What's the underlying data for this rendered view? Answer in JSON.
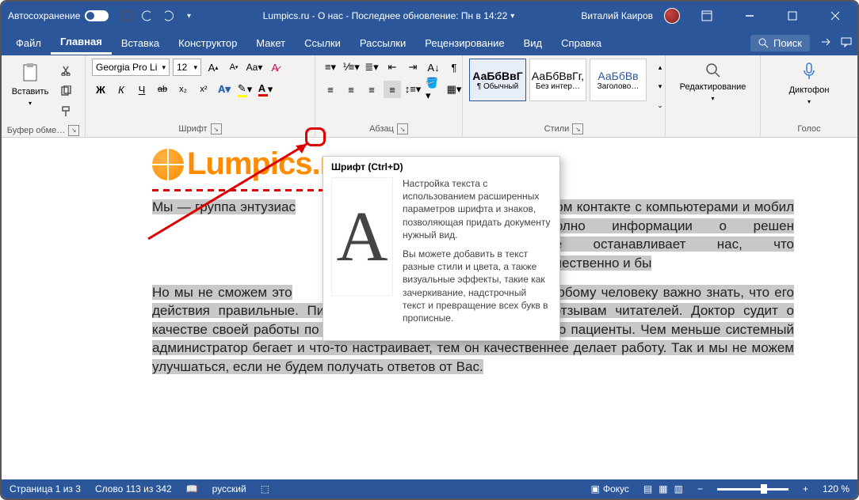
{
  "titlebar": {
    "autosave_label": "Автосохранение",
    "document_title": "Lumpics.ru - О нас - Последнее обновление: Пн в 14:22",
    "user_name": "Виталий Каиров"
  },
  "tabs": {
    "file": "Файл",
    "home": "Главная",
    "insert": "Вставка",
    "design": "Конструктор",
    "layout": "Макет",
    "references": "Ссылки",
    "mailings": "Рассылки",
    "review": "Рецензирование",
    "view": "Вид",
    "help": "Справка",
    "search_placeholder": "Поиск"
  },
  "ribbon": {
    "clipboard": {
      "paste": "Вставить",
      "group": "Буфер обме…"
    },
    "font": {
      "name": "Georgia Pro Li",
      "size": "12",
      "group": "Шрифт",
      "bold": "Ж",
      "italic": "К",
      "underline": "Ч",
      "strike": "ab",
      "sub": "x₂",
      "sup": "x²"
    },
    "paragraph": {
      "group": "Абзац"
    },
    "styles": {
      "group": "Стили",
      "sample": "АаБбВвГ",
      "sample2": "АаБбВвГг,",
      "sample3": "АаБбВв",
      "normal": "¶ Обычный",
      "nospacing": "Без интер…",
      "heading1": "Заголово…"
    },
    "editing": {
      "label": "Редактирование"
    },
    "voice": {
      "label": "Диктофон",
      "group": "Голос"
    }
  },
  "tooltip": {
    "title": "Шрифт (Ctrl+D)",
    "p1": "Настройка текста с использованием расширенных параметров шрифта и знаков, позволяющая придать документу нужный вид.",
    "p2": "Вы можете добавить в текст разные стили и цвета, а также визуальные эффекты, такие как зачеркивание, надстрочный текст и превращение всех букв в прописные."
  },
  "document": {
    "logo_text": "Lumpics.ru",
    "p1a": "Мы — группа энтузиас",
    "p1b": "м в ежедневном контакте с компьютерами и мобил",
    "p1c": "что в интернете уже полно информации о решен",
    "p1d": "омпьютерами. Но это не останавливает нас, что",
    "p1e": "многие проблемы и задачи более качественно и бы",
    "p2a": "Но мы не сможем это",
    "p2b": "и. Любому человеку важно знать, что его действия правильные. Писатель судит о своей работе по отзывам читателей. Доктор судит о качестве своей работы по тому, как быстро выздоравливают его пациенты. Чем меньше системный администратор бегает и что-то настраивает, тем он качественнее делает работу. Так и мы не можем улучшаться, если не будем получать ответов от Вас."
  },
  "statusbar": {
    "page": "Страница 1 из 3",
    "words": "Слово 113 из 342",
    "lang": "русский",
    "focus": "Фокус",
    "zoom": "120 %"
  }
}
